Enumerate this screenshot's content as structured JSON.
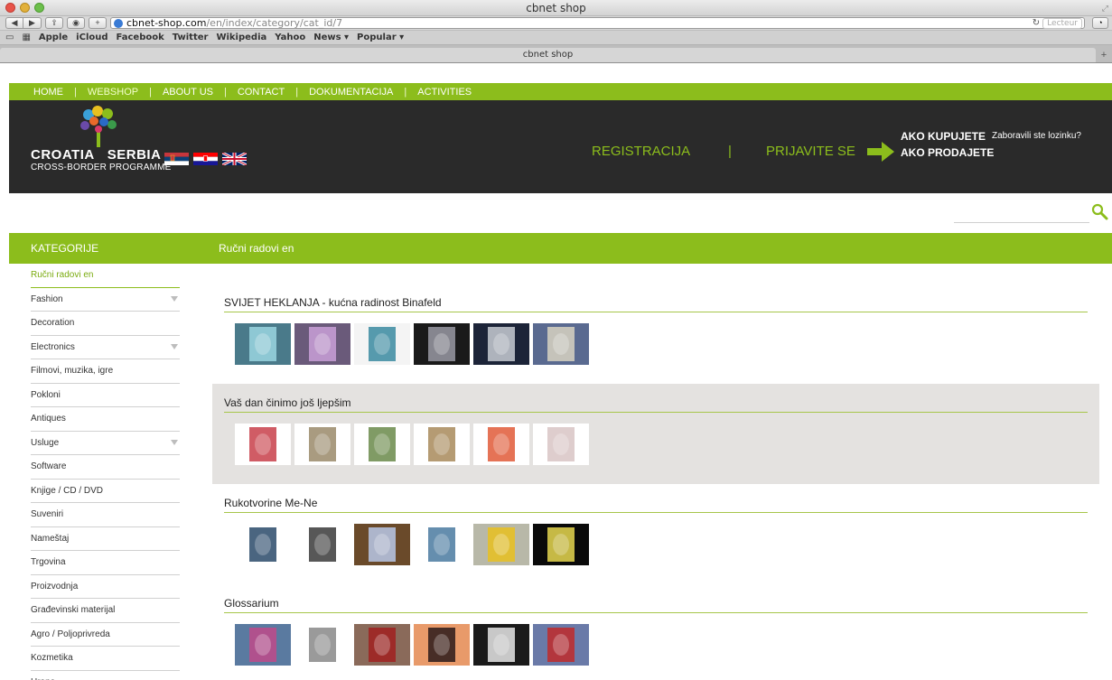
{
  "browser": {
    "window_title": "cbnet shop",
    "url_host": "cbnet-shop.com",
    "url_path": "/en/index/category/cat_id/7",
    "reader_label": "Lecteur",
    "tab_title": "cbnet shop",
    "bookmarks": [
      "Apple",
      "iCloud",
      "Facebook",
      "Twitter",
      "Wikipedia",
      "Yahoo",
      "News ▾",
      "Popular ▾"
    ]
  },
  "site": {
    "nav": [
      "HOME",
      "WEBSHOP",
      "ABOUT US",
      "CONTACT",
      "DOKUMENTACIJA",
      "ACTIVITIES"
    ],
    "nav_sep": "|",
    "logo_title_left": "CROATIA",
    "logo_title_right": "SERBIA",
    "logo_subtitle": "CROSS-BORDER PROGRAMME",
    "register": "REGISTRACIJA",
    "header_sep": "|",
    "login": "PRIJAVITE SE",
    "buyers": "AKO KUPUJETE",
    "sellers": "AKO PRODAJETE",
    "forgot_password": "Zaboravili ste lozinku?",
    "search_placeholder": "",
    "categories_label": "KATEGORIJE",
    "current_category": "Ručni radovi en"
  },
  "sidebar": [
    {
      "label": "Ručni radovi en",
      "active": true,
      "has_children": false
    },
    {
      "label": "Fashion",
      "active": false,
      "has_children": true
    },
    {
      "label": "Decoration",
      "active": false,
      "has_children": false
    },
    {
      "label": "Electronics",
      "active": false,
      "has_children": true
    },
    {
      "label": "Filmovi, muzika, igre",
      "active": false,
      "has_children": false
    },
    {
      "label": "Pokloni",
      "active": false,
      "has_children": false
    },
    {
      "label": "Antiques",
      "active": false,
      "has_children": false
    },
    {
      "label": "Usluge",
      "active": false,
      "has_children": true
    },
    {
      "label": "Software",
      "active": false,
      "has_children": false
    },
    {
      "label": "Knjige / CD / DVD",
      "active": false,
      "has_children": false
    },
    {
      "label": "Suveniri",
      "active": false,
      "has_children": false
    },
    {
      "label": "Nameštaj",
      "active": false,
      "has_children": false
    },
    {
      "label": "Trgovina",
      "active": false,
      "has_children": false
    },
    {
      "label": "Proizvodnja",
      "active": false,
      "has_children": false
    },
    {
      "label": "Građevinski materijal",
      "active": false,
      "has_children": false
    },
    {
      "label": "Agro / Poljoprivreda",
      "active": false,
      "has_children": false
    },
    {
      "label": "Kozmetika",
      "active": false,
      "has_children": false
    },
    {
      "label": "Hrana",
      "active": false,
      "has_children": false
    }
  ],
  "shops": [
    {
      "title": "SVIJET HEKLANJA - kućna radinost Binafeld",
      "shaded": false,
      "thumbs": [
        [
          "#4a7a8a",
          "#9ad6e0"
        ],
        [
          "#6a5a7a",
          "#c9a0d8"
        ],
        [
          "#f4f4f4",
          "#3a8aa0"
        ],
        [
          "#1a1a1a",
          "#9a9aa4"
        ],
        [
          "#1c2438",
          "#c8ccd4"
        ],
        [
          "#5a6a90",
          "#d8d2c2"
        ]
      ]
    },
    {
      "title": "Vaš dan činimo još ljepšim",
      "shaded": true,
      "thumbs": [
        [
          "#ffffff",
          "#c8404a"
        ],
        [
          "#ffffff",
          "#9a8a6a"
        ],
        [
          "#ffffff",
          "#6a8a4a"
        ],
        [
          "#ffffff",
          "#a88a5a"
        ],
        [
          "#ffffff",
          "#e05a38"
        ],
        [
          "#ffffff",
          "#d8c4c4"
        ]
      ]
    },
    {
      "title": "Rukotvorine Me-Ne",
      "shaded": false,
      "thumbs": [
        [
          "#ffffff",
          "#2a4a6a"
        ],
        [
          "#ffffff",
          "#3a3a3a"
        ],
        [
          "#6a4a2a",
          "#b8c8e8"
        ],
        [
          "#ffffff",
          "#4a7aa0"
        ],
        [
          "#b8b8a8",
          "#e8c020"
        ],
        [
          "#0a0a0a",
          "#e8d850"
        ]
      ]
    },
    {
      "title": "Glossarium",
      "shaded": false,
      "thumbs": [
        [
          "#5a7aa0",
          "#c04a8a"
        ],
        [
          "#ffffff",
          "#888888"
        ],
        [
          "#8a6a5a",
          "#a02020"
        ],
        [
          "#e89a6a",
          "#2a1a1a"
        ],
        [
          "#1a1a1a",
          "#e8e8e8"
        ],
        [
          "#6a7aa8",
          "#c02a2a"
        ]
      ]
    }
  ],
  "colors": {
    "brand_green": "#8cbd1c",
    "header_dark": "#2a2a2a"
  },
  "icons": [
    "search-icon",
    "arrow-right-icon",
    "flag-serbia-icon",
    "flag-croatia-icon",
    "flag-uk-icon"
  ]
}
